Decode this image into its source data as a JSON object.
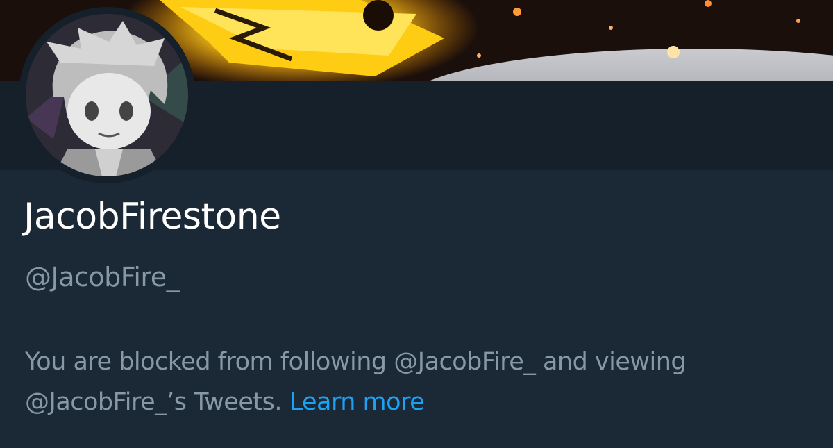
{
  "profile": {
    "display_name": "JacobFirestone",
    "handle": "@JacobFire_"
  },
  "block_notice": {
    "message": "You are blocked from following @JacobFire_ and viewing @JacobFire_’s Tweets.",
    "link_label": "Learn more"
  },
  "colors": {
    "background": "#1b2836",
    "header_band": "#15202b",
    "primary_text": "#ffffff",
    "secondary_text": "#8899a6",
    "link": "#1da1f2",
    "divider": "#38444d"
  }
}
